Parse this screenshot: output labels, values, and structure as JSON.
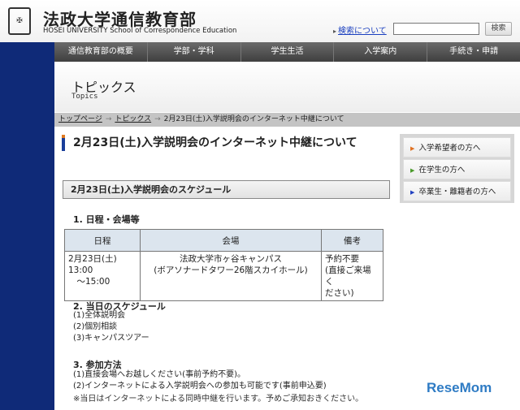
{
  "header": {
    "logo_text": "HOSEI",
    "title": "法政大学通信教育部",
    "subtitle": "HOSEI UNIVERSITY  School of Correspondence Education",
    "search_link": "検索について",
    "search_value": "",
    "search_button": "検索"
  },
  "nav": [
    "通信教育部の概要",
    "学部・学科",
    "学生生活",
    "入学案内",
    "手続き・申請"
  ],
  "topics": {
    "title": "トピックス",
    "subtitle": "Topics"
  },
  "breadcrumb": {
    "items": [
      "トップページ",
      "トピックス"
    ],
    "current": "2月23日(土)入学説明会のインターネット中継について",
    "sep": "→"
  },
  "main": {
    "title": "2月23日(土)入学説明会のインターネット中継について",
    "section": "2月23日(土)入学説明会のスケジュール",
    "h1": "1. 日程・会場等",
    "table": {
      "headers": [
        "日程",
        "会場",
        "備考"
      ],
      "row": {
        "date": [
          "2月23日(土)",
          "13:00",
          "　～15:00"
        ],
        "venue": [
          "法政大学市ヶ谷キャンパス",
          "(ボアソナードタワー26階スカイホール)"
        ],
        "note": [
          "予約不要",
          "(直接ご来場く",
          "ださい)"
        ]
      }
    },
    "h2": "2. 当日のスケジュール",
    "schedule": [
      "(1)全体説明会",
      "(2)個別相談",
      "(3)キャンパスツアー"
    ],
    "h3": "3. 参加方法",
    "methods": [
      "(1)直接会場へお越しください(事前予約不要)。",
      "(2)インターネットによる入学説明会への参加も可能です(事前申込要)"
    ],
    "notice": "※当日はインターネットによる同時中継を行います。予めご承知おきください。"
  },
  "sidebar": [
    {
      "label": "入学希望者の方へ",
      "color": "#e07020"
    },
    {
      "label": "在学生の方へ",
      "color": "#4a9a2a"
    },
    {
      "label": "卒業生・離籍者の方へ",
      "color": "#2040c0"
    }
  ],
  "watermark": "ReseMom"
}
